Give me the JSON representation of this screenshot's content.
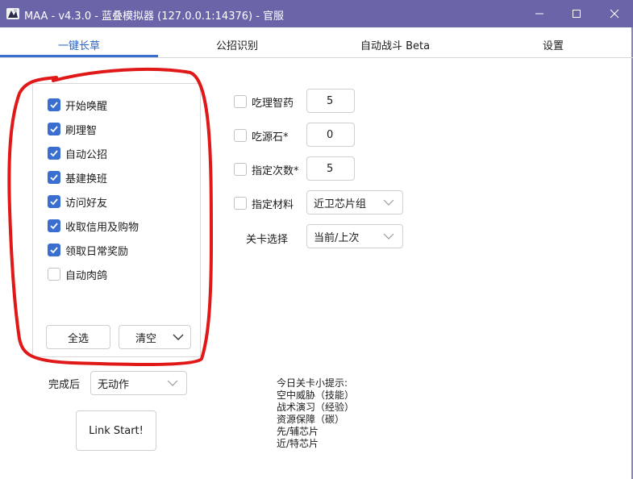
{
  "window": {
    "title": "MAA - v4.3.0 - 蓝叠模拟器 (127.0.0.1:14376) - 官服",
    "titlebar_color": "#6a65a8"
  },
  "tabs": [
    {
      "label": "一键长草"
    },
    {
      "label": "公招识别"
    },
    {
      "label": "自动战斗 Beta"
    },
    {
      "label": "设置"
    }
  ],
  "tasks": [
    {
      "label": "开始唤醒",
      "checked": true
    },
    {
      "label": "刷理智",
      "checked": true
    },
    {
      "label": "自动公招",
      "checked": true
    },
    {
      "label": "基建换班",
      "checked": true
    },
    {
      "label": "访问好友",
      "checked": true
    },
    {
      "label": "收取信用及购物",
      "checked": true
    },
    {
      "label": "领取日常奖励",
      "checked": true
    },
    {
      "label": "自动肉鸽",
      "checked": false
    }
  ],
  "task_buttons": {
    "select_all": "全选",
    "clear": "清空"
  },
  "after_completion": {
    "label": "完成后",
    "value": "无动作"
  },
  "link_start": "Link Start!",
  "options": {
    "use_sanity_potion": {
      "label": "吃理智药",
      "checked": false,
      "value": "5"
    },
    "use_originium": {
      "label": "吃源石*",
      "checked": false,
      "value": "0"
    },
    "times": {
      "label": "指定次数*",
      "checked": false,
      "value": "5"
    },
    "material": {
      "label": "指定材料",
      "checked": false,
      "value": "近卫芯片组"
    }
  },
  "stage": {
    "label": "关卡选择",
    "value": "当前/上次"
  },
  "tips": [
    "今日关卡小提示:",
    "空中威胁（技能）",
    "战术演习（经验）",
    "资源保障（碳）",
    "先/辅芯片",
    "近/特芯片"
  ],
  "colors": {
    "accent": "#3a6fd1",
    "annotation": "#e01818"
  },
  "icons": {
    "app": "app-icon",
    "minimize": "minimize-icon",
    "maximize": "maximize-icon",
    "close": "close-icon",
    "dropdown": "chevron-down-icon",
    "check": "checkmark-icon"
  }
}
